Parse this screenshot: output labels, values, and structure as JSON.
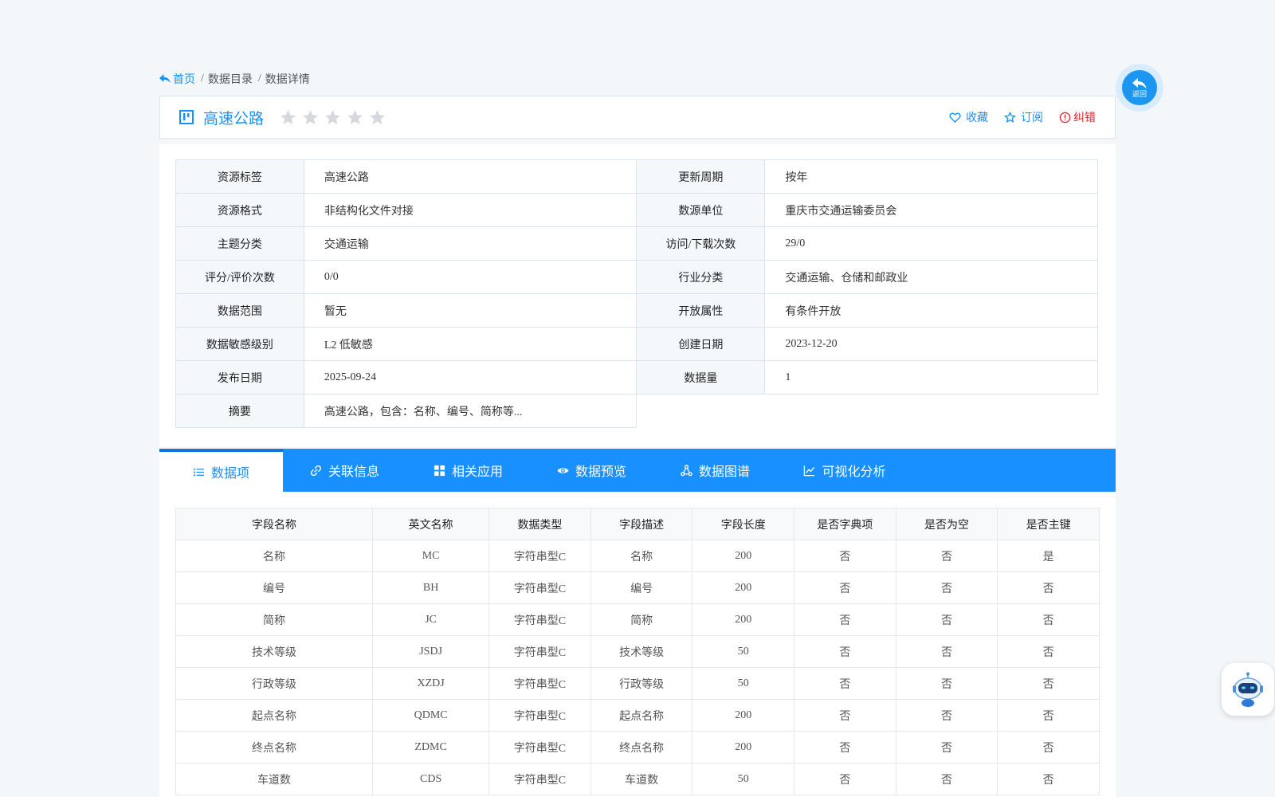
{
  "breadcrumb": {
    "home": "首页",
    "sep": "/",
    "catalog": "数据目录",
    "detail": "数据详情"
  },
  "title": {
    "text": "高速公路",
    "rating_stars_filled": 0,
    "rating_stars_total": 5
  },
  "actions": {
    "favorite": "收藏",
    "subscribe": "订阅",
    "report": "纠错"
  },
  "back_button": {
    "label": "返回"
  },
  "info": {
    "rows": [
      {
        "l1": "资源标签",
        "v1": "高速公路",
        "l2": "更新周期",
        "v2": "按年"
      },
      {
        "l1": "资源格式",
        "v1": "非结构化文件对接",
        "l2": "数源单位",
        "v2": "重庆市交通运输委员会"
      },
      {
        "l1": "主题分类",
        "v1": "交通运输",
        "l2": "访问/下载次数",
        "v2": "29/0"
      },
      {
        "l1": "评分/评价次数",
        "v1": "0/0",
        "l2": "行业分类",
        "v2": "交通运输、仓储和邮政业"
      },
      {
        "l1": "数据范围",
        "v1": "暂无",
        "l2": "开放属性",
        "v2": "有条件开放"
      },
      {
        "l1": "数据敏感级别",
        "v1": "L2 低敏感",
        "l2": "创建日期",
        "v2": "2023-12-20"
      },
      {
        "l1": "发布日期",
        "v1": "2025-09-24",
        "l2": "数据量",
        "v2": "1"
      },
      {
        "l1": "摘要",
        "v1": "高速公路，包含：名称、编号、简称等..."
      }
    ]
  },
  "tabs": [
    {
      "label": "数据项",
      "icon": "list-icon",
      "active": true
    },
    {
      "label": "关联信息",
      "icon": "link-icon"
    },
    {
      "label": "相关应用",
      "icon": "grid-icon"
    },
    {
      "label": "数据预览",
      "icon": "eye-icon"
    },
    {
      "label": "数据图谱",
      "icon": "graph-icon"
    },
    {
      "label": "可视化分析",
      "icon": "chart-line-icon"
    }
  ],
  "fields": {
    "headers": [
      "字段名称",
      "英文名称",
      "数据类型",
      "字段描述",
      "字段长度",
      "是否字典项",
      "是否为空",
      "是否主键"
    ],
    "rows": [
      [
        "名称",
        "MC",
        "字符串型C",
        "名称",
        "200",
        "否",
        "否",
        "是"
      ],
      [
        "编号",
        "BH",
        "字符串型C",
        "编号",
        "200",
        "否",
        "否",
        "否"
      ],
      [
        "简称",
        "JC",
        "字符串型C",
        "简称",
        "200",
        "否",
        "否",
        "否"
      ],
      [
        "技术等级",
        "JSDJ",
        "字符串型C",
        "技术等级",
        "50",
        "否",
        "否",
        "否"
      ],
      [
        "行政等级",
        "XZDJ",
        "字符串型C",
        "行政等级",
        "50",
        "否",
        "否",
        "否"
      ],
      [
        "起点名称",
        "QDMC",
        "字符串型C",
        "起点名称",
        "200",
        "否",
        "否",
        "否"
      ],
      [
        "终点名称",
        "ZDMC",
        "字符串型C",
        "终点名称",
        "200",
        "否",
        "否",
        "否"
      ],
      [
        "车道数",
        "CDS",
        "字符串型C",
        "车道数",
        "50",
        "否",
        "否",
        "否"
      ]
    ]
  },
  "colors": {
    "primary": "#1890ff",
    "danger": "#e0252b",
    "star_empty": "#d5d9de"
  }
}
